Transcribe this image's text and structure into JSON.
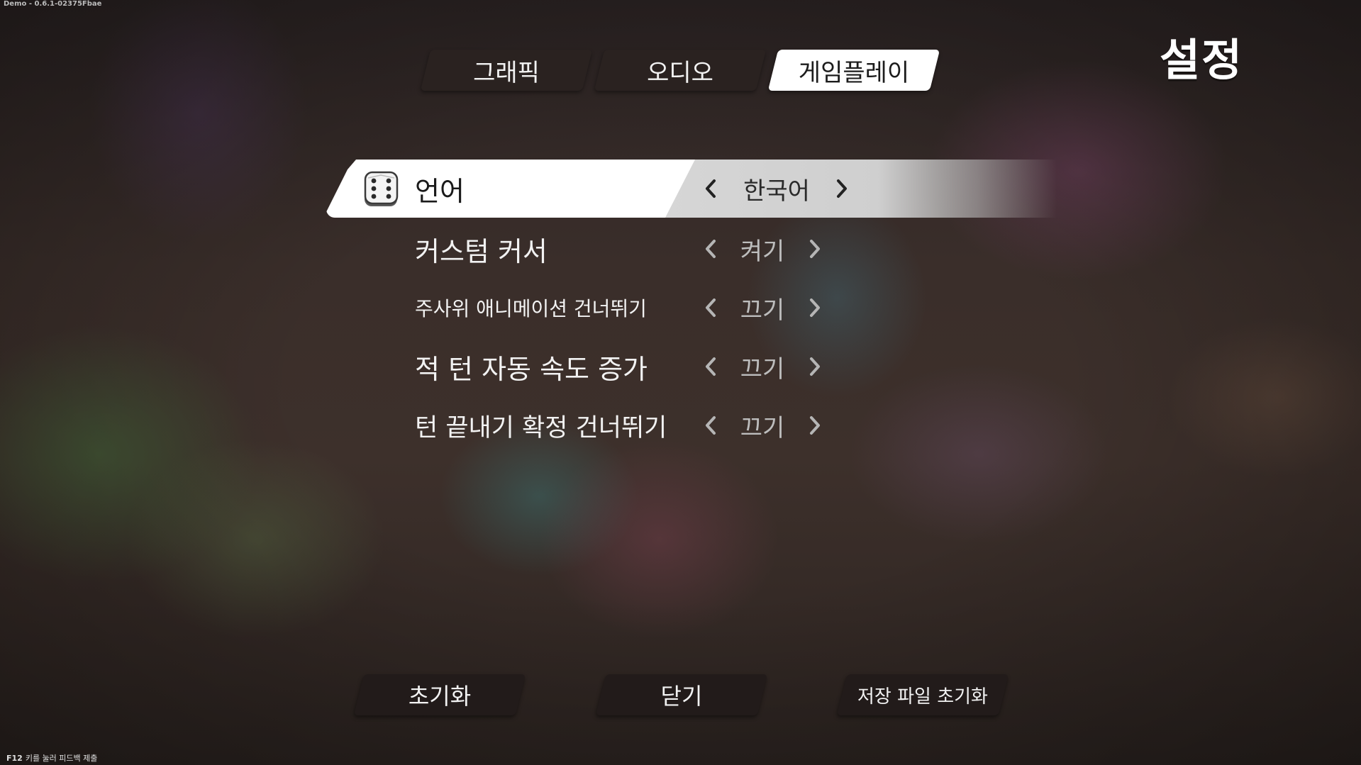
{
  "build_label": "Demo - 0.6.1-02375Fbae",
  "page_title": "설정",
  "tabs": [
    {
      "label": "그래픽",
      "active": false
    },
    {
      "label": "오디오",
      "active": false
    },
    {
      "label": "게임플레이",
      "active": true
    }
  ],
  "settings": [
    {
      "label": "언어",
      "value": "한국어",
      "selected": true
    },
    {
      "label": "커스텀 커서",
      "value": "켜기"
    },
    {
      "label": "주사위 애니메이션 건너뛰기",
      "value": "끄기"
    },
    {
      "label": "적 턴 자동 속도 증가",
      "value": "끄기"
    },
    {
      "label": "턴 끝내기 확정 건너뛰기",
      "value": "끄기"
    }
  ],
  "buttons": {
    "reset": "초기화",
    "close": "닫기",
    "reset_save": "저장 파일 초기화"
  },
  "footer": {
    "key": "F12",
    "text": "키를 눌러 피드백 제출"
  },
  "icons": {
    "selected_row_icon": "dice-icon",
    "prev": "chevron-left-icon",
    "next": "chevron-right-icon"
  }
}
